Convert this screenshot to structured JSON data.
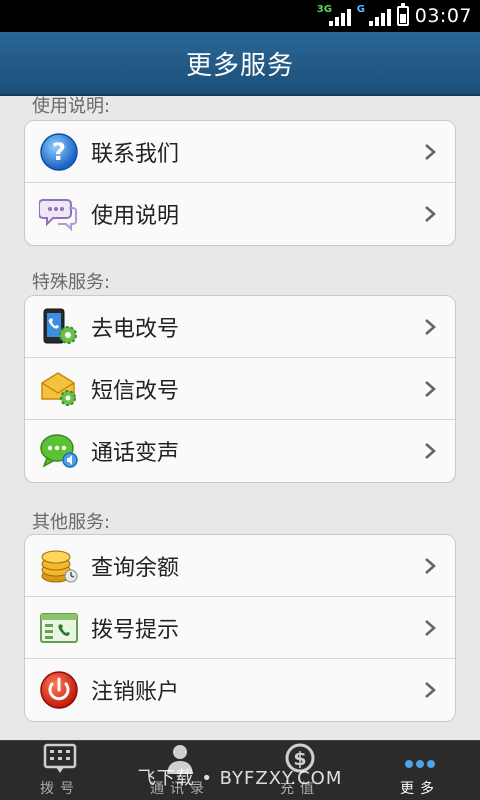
{
  "status_bar": {
    "network1": "3G",
    "network2": "G",
    "time": "03:07"
  },
  "header": {
    "title": "更多服务"
  },
  "sections": [
    {
      "title": "使用说明:",
      "items": [
        {
          "label": "联系我们",
          "icon": "help-icon"
        },
        {
          "label": "使用说明",
          "icon": "chat-bubbles-icon"
        }
      ]
    },
    {
      "title": "特殊服务:",
      "items": [
        {
          "label": "去电改号",
          "icon": "phone-gear-icon"
        },
        {
          "label": "短信改号",
          "icon": "envelope-gear-icon"
        },
        {
          "label": "通话变声",
          "icon": "voice-bubble-icon"
        }
      ]
    },
    {
      "title": "其他服务:",
      "items": [
        {
          "label": "查询余额",
          "icon": "coins-icon"
        },
        {
          "label": "拨号提示",
          "icon": "dial-tip-icon"
        },
        {
          "label": "注销账户",
          "icon": "power-icon"
        }
      ]
    }
  ],
  "tabs": [
    {
      "label": "拨号",
      "icon": "dialpad-icon"
    },
    {
      "label": "通讯录",
      "icon": "contacts-icon"
    },
    {
      "label": "充值",
      "icon": "recharge-icon"
    },
    {
      "label": "更多",
      "icon": "more-icon"
    }
  ],
  "watermark": "飞下载 • BYFZXY.COM",
  "colors": {
    "header": "#1f567f",
    "tabbar": "#2b2b2b",
    "active_dots": "#4da3e8"
  }
}
